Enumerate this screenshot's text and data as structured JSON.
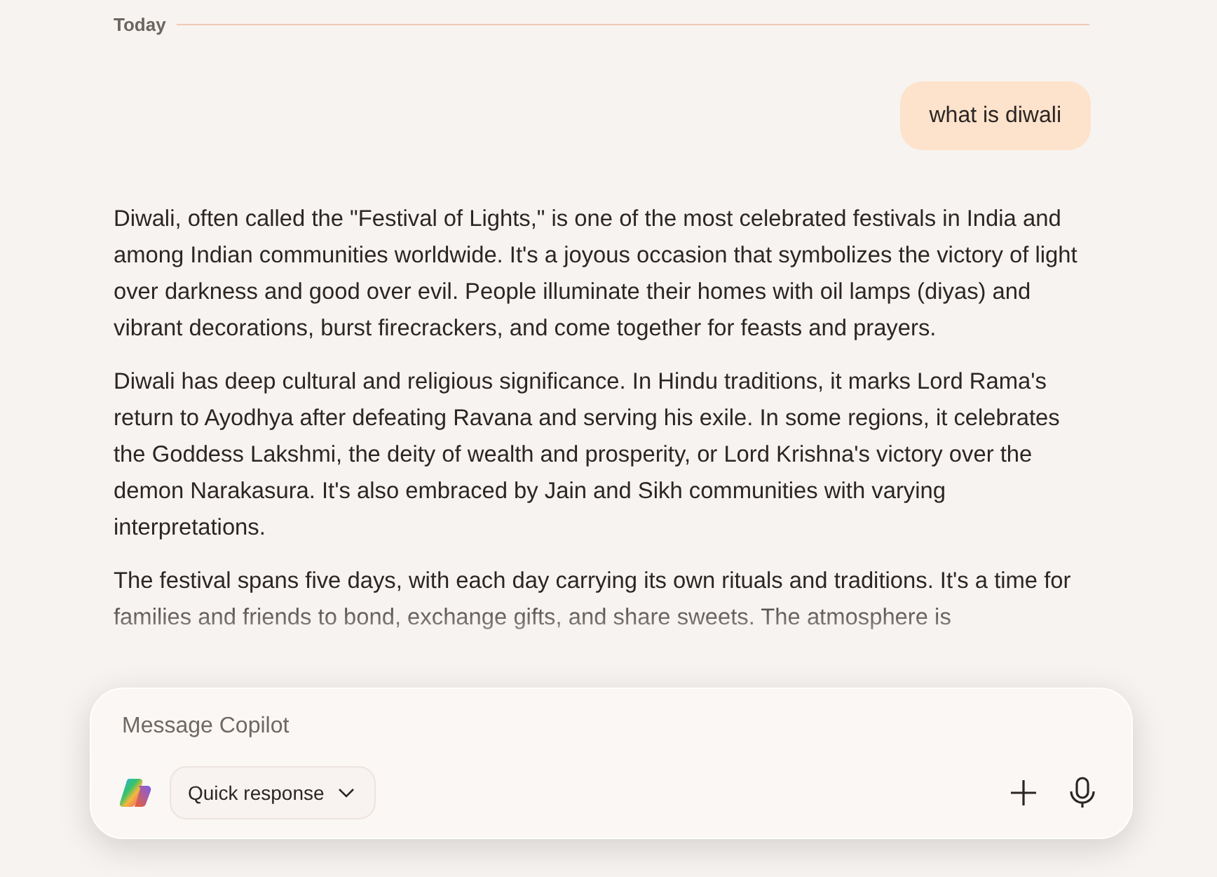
{
  "divider": {
    "label": "Today"
  },
  "messages": [
    {
      "kind": "user",
      "text": "what is diwali"
    }
  ],
  "answer": {
    "paragraphs": [
      "Diwali, often called the \"Festival of Lights,\" is one of the most celebrated festivals in India and among Indian communities worldwide. It's a joyous occasion that symbolizes the victory of light over darkness and good over evil. People illuminate their homes with oil lamps (diyas) and vibrant decorations, burst firecrackers, and come together for feasts and prayers.",
      "Diwali has deep cultural and religious significance. In Hindu traditions, it marks Lord Rama's return to Ayodhya after defeating Ravana and serving his exile. In some regions, it celebrates the Goddess Lakshmi, the deity of wealth and prosperity, or Lord Krishna's victory over the demon Narakasura. It's also embraced by Jain and Sikh communities with varying interpretations.",
      "The festival spans five days, with each day carrying its own rituals and traditions. It's a time for families and friends to bond, exchange gifts, and share sweets. The atmosphere is"
    ]
  },
  "composer": {
    "placeholder": "Message Copilot",
    "mode": "Quick response"
  }
}
